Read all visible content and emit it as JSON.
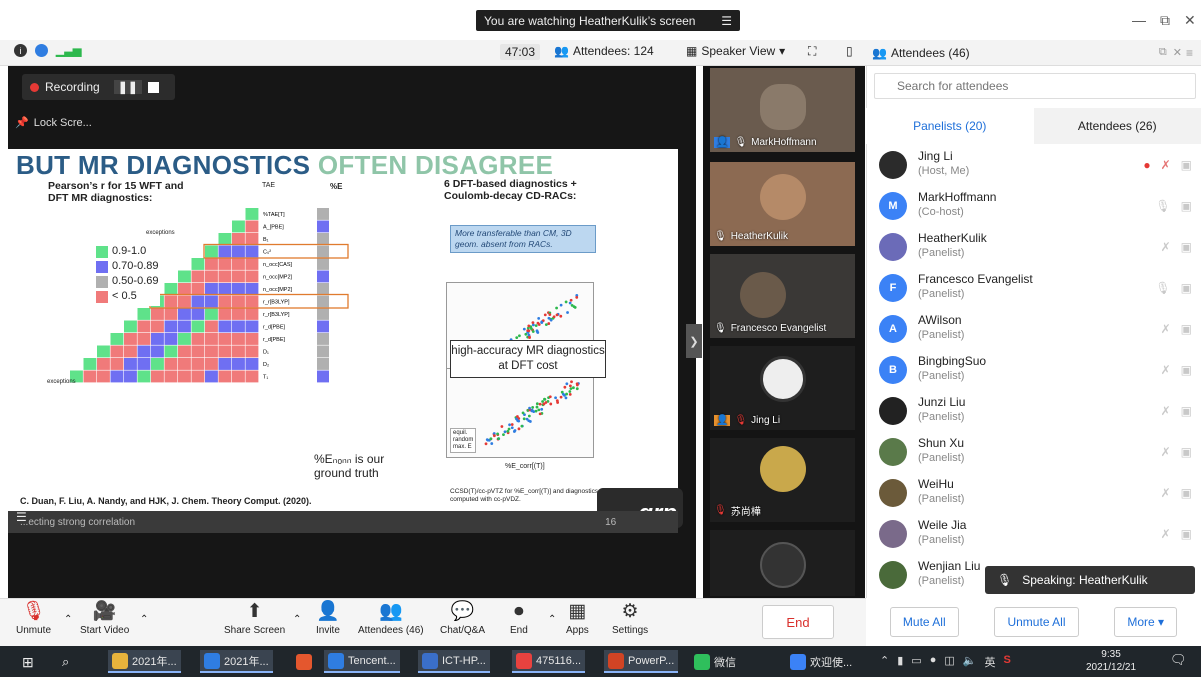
{
  "window": {
    "watch_banner": "You are watching HeatherKulik’s screen",
    "minimize_icon": "minimize-icon",
    "restore_icon": "restore-icon",
    "close_icon": "close-icon"
  },
  "meeting_toolbar": {
    "timer": "47:03",
    "attendees_count_label": "Attendees: 124",
    "view_label": "Speaker View"
  },
  "recording": {
    "label": "Recording",
    "lock_screen": "Lock Scre..."
  },
  "slide": {
    "title_main": "BUT MR DIAGNOSTICS",
    "title_hl": "OFTEN DISAGREE",
    "pearson_text": "Pearson’s r for 15 WFT and DFT MR diagnostics:",
    "legend": [
      {
        "label": "0.9-1.0",
        "color": "#5fe28a"
      },
      {
        "label": "0.70-0.89",
        "color": "#6f6ff2"
      },
      {
        "label": "0.50-0.69",
        "color": "#b0b0b0"
      },
      {
        "label": "< 0.5",
        "color": "#f07a7a"
      }
    ],
    "col_header_a": "TAE",
    "col_header_b": "%E",
    "exceptions_1": "exceptions",
    "exceptions_2": "exceptions",
    "row_labels": [
      "%TAE[T]",
      "A_[PBE]",
      "B₁",
      "C₀²",
      "n_occ[CAS]",
      "n_occ[MP2]",
      "n_occ[MP2]",
      "r_r[B3LYP]",
      "r_r[B3LYP]",
      "r_d[PBE]",
      "r_d[PBE]",
      "D₁",
      "D₂",
      "T₁"
    ],
    "percent_text": "%Eₙₒₙₙ is our ground truth",
    "dft_text": "6 DFT-based diagnostics + Coulomb-decay CD-RACs:",
    "blue_box": "More transferable than CM, 3D geom. absent from RACs.",
    "callout": "high-accuracy MR diagnostics at DFT cost",
    "graph_legend": [
      "equil.",
      "random",
      "max. E"
    ],
    "x_axis_label": "%E_corr[(T)]",
    "ccsd_note": "CCSD(T)/cc-pVTZ for %E_corr[(T)] and diagnostics computed with cc-pVDZ.",
    "citation": "C. Duan, F. Liu, A. Nandy, and HJK, J. Chem. Theory Comput. (2020).",
    "footer_left": "...ecting strong correlation",
    "page_num": "16",
    "logo": "grp"
  },
  "gallery": [
    {
      "name": "MarkHoffmann",
      "bg": "#6a5b4e"
    },
    {
      "name": "HeatherKulik",
      "bg": "#8c6a52"
    },
    {
      "name": "Francesco Evangelist",
      "bg": "#3a3836"
    },
    {
      "name": "Jing Li",
      "bg": "#1e1e1e"
    },
    {
      "name": "苏尚樺",
      "bg": "#1e1e1e"
    },
    {
      "name": "",
      "bg": "#1e1e1e"
    }
  ],
  "panel": {
    "title": "Attendees (46)",
    "search_placeholder": "Search for attendees",
    "tab_panelists": "Panelists (20)",
    "tab_attendees": "Attendees (26)",
    "people": [
      {
        "name": "Jing Li",
        "role": "(Host, Me)",
        "initial": "",
        "color": "#2b2b2b"
      },
      {
        "name": "MarkHoffmann",
        "role": "(Co-host)",
        "initial": "M",
        "color": "#3b82f6"
      },
      {
        "name": "HeatherKulik",
        "role": "(Panelist)",
        "initial": "",
        "color": "#6b6bb8"
      },
      {
        "name": "Francesco Evangelist",
        "role": "(Panelist)",
        "initial": "F",
        "color": "#3b82f6"
      },
      {
        "name": "AWilson",
        "role": "(Panelist)",
        "initial": "A",
        "color": "#3b82f6"
      },
      {
        "name": "BingbingSuo",
        "role": "(Panelist)",
        "initial": "B",
        "color": "#3b82f6"
      },
      {
        "name": "Junzi Liu",
        "role": "(Panelist)",
        "initial": "",
        "color": "#222"
      },
      {
        "name": "Shun Xu",
        "role": "(Panelist)",
        "initial": "",
        "color": "#5a7a4a"
      },
      {
        "name": "WeiHu",
        "role": "(Panelist)",
        "initial": "",
        "color": "#6b5a3a"
      },
      {
        "name": "Weile Jia",
        "role": "(Panelist)",
        "initial": "",
        "color": "#7a6a8a"
      },
      {
        "name": "Wenjian Liu",
        "role": "(Panelist)",
        "initial": "",
        "color": "#4a6a3a"
      }
    ],
    "speaking": "Speaking: HeatherKulik",
    "mute_all": "Mute All",
    "unmute_all": "Unmute All",
    "more": "More ▾"
  },
  "bottom": {
    "unmute": "Unmute",
    "start_video": "Start Video",
    "share_screen": "Share Screen",
    "invite": "Invite",
    "attendees": "Attendees (46)",
    "chat": "Chat/Q&A",
    "end_rec": "End",
    "apps": "Apps",
    "settings": "Settings",
    "end_button": "End"
  },
  "taskbar": {
    "items": [
      {
        "label": "2021年...",
        "color": "#e7b33c"
      },
      {
        "label": "2021年...",
        "color": "#2f7de1"
      },
      {
        "label": "",
        "color": "#e4572e"
      },
      {
        "label": "Tencent...",
        "color": "#2f7de1"
      },
      {
        "label": "ICT-HP...",
        "color": "#3a6fc9"
      },
      {
        "label": "475116...",
        "color": "#e8423f"
      },
      {
        "label": "PowerP...",
        "color": "#d14424"
      },
      {
        "label": "微信",
        "color": "#2fbf5c"
      },
      {
        "label": "欢迎使...",
        "color": "#3b82f6"
      }
    ],
    "lang": "英",
    "time": "9:35",
    "date": "2021/12/21"
  }
}
